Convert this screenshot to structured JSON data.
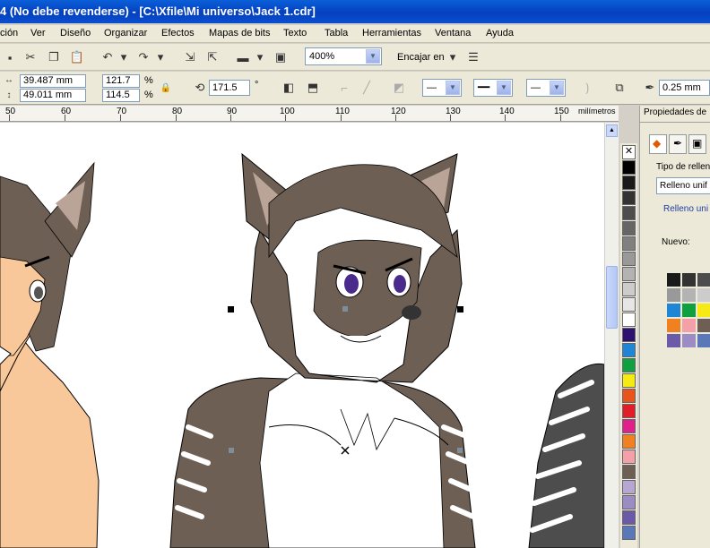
{
  "window": {
    "title": "4 (No debe revenderse) - [C:\\Xfile\\Mi universo\\Jack 1.cdr]"
  },
  "menu": {
    "items": [
      "ción",
      "Ver",
      "Diseño",
      "Organizar",
      "Efectos",
      "Mapas de bits",
      "Texto",
      "Tabla",
      "Herramientas",
      "Ventana",
      "Ayuda"
    ]
  },
  "toolbar": {
    "zoom_value": "400%",
    "snap_label": "Encajar en"
  },
  "propertybar": {
    "width_value": "39.487 mm",
    "height_value": "49.011 mm",
    "scale_x": "121.7",
    "scale_y": "114.5",
    "percent": "%",
    "rotation": "171.5",
    "degree": "°",
    "outline_width": "0.25 mm"
  },
  "ruler": {
    "labels": [
      "50",
      "60",
      "70",
      "80",
      "90",
      "100",
      "110",
      "120",
      "130",
      "140",
      "150"
    ],
    "unit": "milímetros"
  },
  "docker": {
    "title": "Propiedades de",
    "fill_type_label": "Tipo de relleno",
    "fill_type_value": "Relleno unif",
    "section_label": "Relleno uni",
    "new_label": "Nuevo:"
  },
  "colors": {
    "titlebar": "#0a4fcf",
    "fur_dark": "#6e5f54",
    "skin": "#f9c89a",
    "eye": "#4a2a8a"
  }
}
